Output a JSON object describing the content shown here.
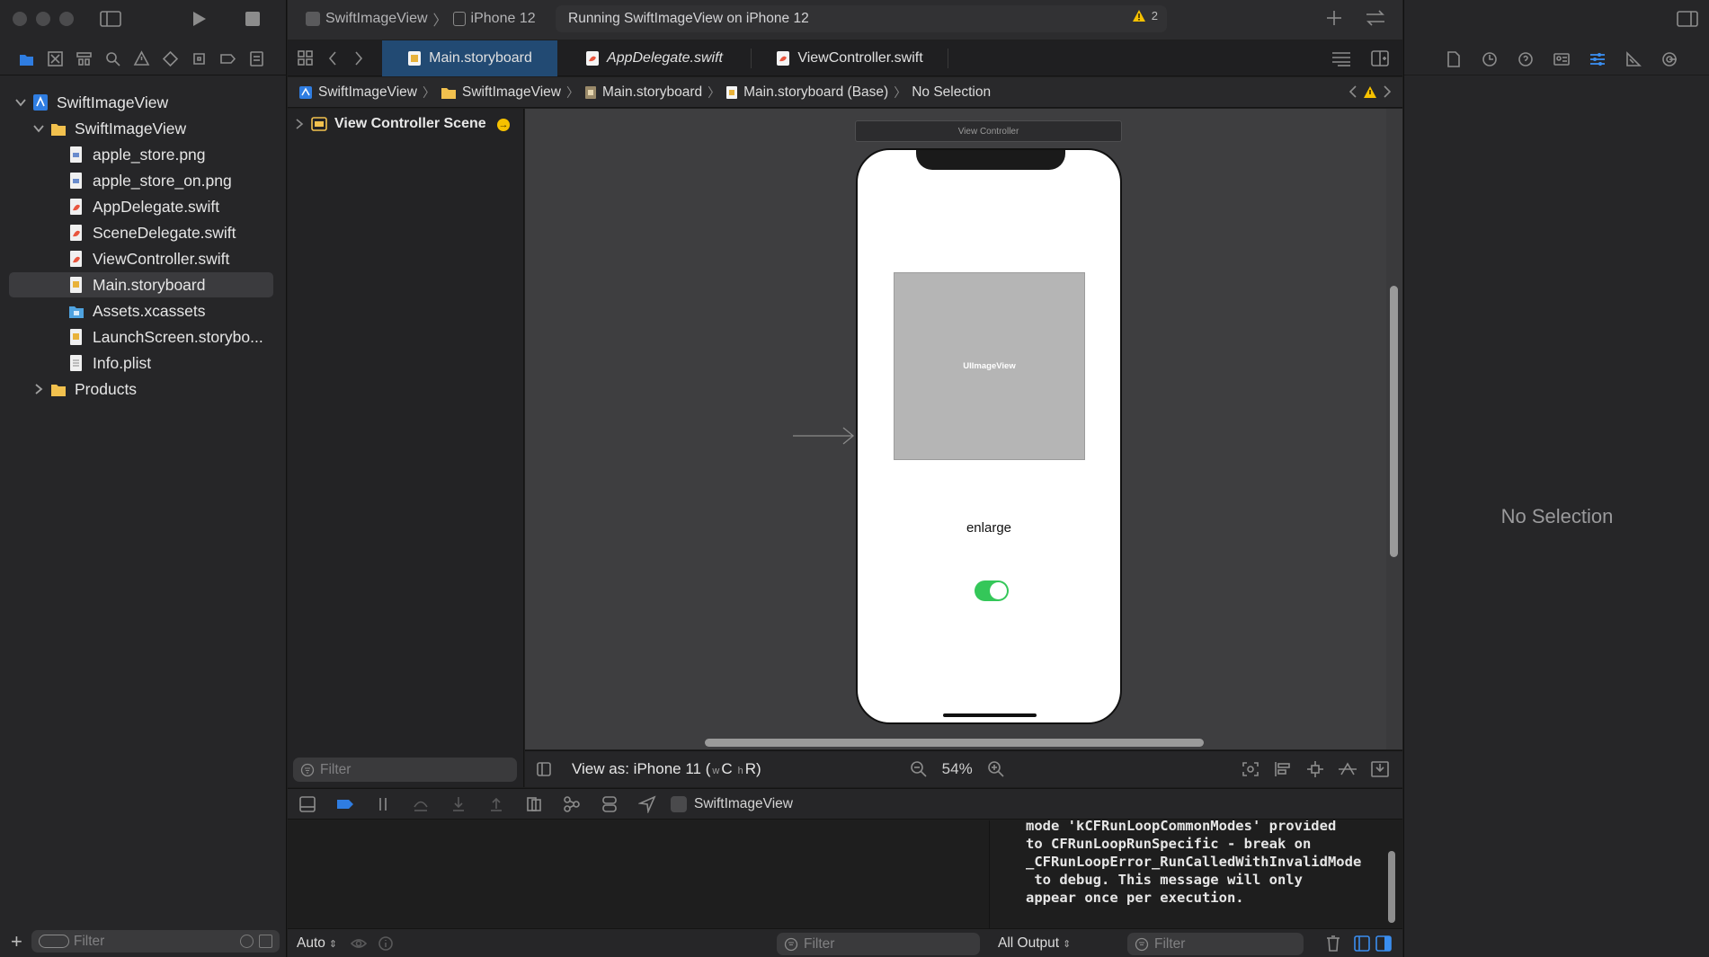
{
  "window": {
    "scheme_project": "SwiftImageView",
    "scheme_device": "iPhone 12",
    "activity_status": "Running SwiftImageView on iPhone 12",
    "warning_count": "2"
  },
  "navigator": {
    "items": [
      {
        "label": "SwiftImageView",
        "icon": "xcodeproj-icon",
        "level": 0,
        "expanded": true
      },
      {
        "label": "SwiftImageView",
        "icon": "folder-icon",
        "level": 1,
        "expanded": true
      },
      {
        "label": "apple_store.png",
        "icon": "image-file-icon",
        "level": 2
      },
      {
        "label": "apple_store_on.png",
        "icon": "image-file-icon",
        "level": 2
      },
      {
        "label": "AppDelegate.swift",
        "icon": "swift-file-icon",
        "level": 2
      },
      {
        "label": "SceneDelegate.swift",
        "icon": "swift-file-icon",
        "level": 2
      },
      {
        "label": "ViewController.swift",
        "icon": "swift-file-icon",
        "level": 2
      },
      {
        "label": "Main.storyboard",
        "icon": "storyboard-icon",
        "level": 2,
        "selected": true
      },
      {
        "label": "Assets.xcassets",
        "icon": "assets-folder-icon",
        "level": 2
      },
      {
        "label": "LaunchScreen.storybo...",
        "icon": "storyboard-icon",
        "level": 2
      },
      {
        "label": "Info.plist",
        "icon": "plist-file-icon",
        "level": 2
      },
      {
        "label": "Products",
        "icon": "folder-icon",
        "level": 1,
        "expanded": false
      }
    ],
    "filter_placeholder": "Filter"
  },
  "tabs": [
    {
      "label": "Main.storyboard",
      "active": true
    },
    {
      "label": "AppDelegate.swift",
      "active": false
    },
    {
      "label": "ViewController.swift",
      "active": false
    }
  ],
  "jumpbar": {
    "crumbs": [
      "SwiftImageView",
      "SwiftImageView",
      "Main.storyboard",
      "Main.storyboard (Base)",
      "No Selection"
    ]
  },
  "outline": {
    "scene": "View Controller Scene",
    "filter_placeholder": "Filter"
  },
  "canvas": {
    "vc_title": "View Controller",
    "imageview_label": "UIImageView",
    "enlarge_label": "enlarge",
    "switch_on": true,
    "view_as": "View as: iPhone 11 (",
    "size_class_w": "w",
    "size_class_wv": "C",
    "size_class_h": "h",
    "size_class_hv": "R)",
    "zoom": "54%"
  },
  "debug": {
    "process": "SwiftImageView",
    "console_text": "mode 'kCFRunLoopCommonModes' provided\nto CFRunLoopRunSpecific - break on\n_CFRunLoopError_RunCalledWithInvalidMode\n to debug. This message will only\nappear once per execution.",
    "auto_label": "Auto",
    "vars_filter_placeholder": "Filter",
    "output_select": "All Output",
    "console_filter_placeholder": "Filter"
  },
  "inspector": {
    "empty_text": "No Selection"
  },
  "colors": {
    "accent": "#224a73",
    "switch_on": "#34c759",
    "warning": "#f6c100",
    "swift": "#e8553e",
    "folder": "#f2c14e",
    "project_blue": "#2f7de1"
  }
}
